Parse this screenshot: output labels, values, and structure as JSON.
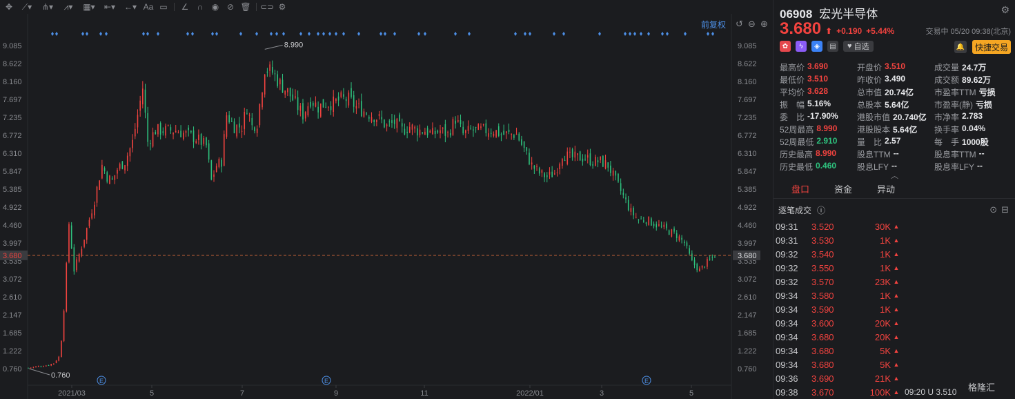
{
  "toolbar": {
    "icons": [
      "crosshair-icon",
      "line-tool-icon",
      "pitchfork-icon",
      "pattern-icon",
      "measure-icon",
      "range-icon",
      "arrow-tool-icon",
      "text-tool-icon",
      "comment-icon",
      "angle-icon",
      "magnet-icon",
      "eye-icon",
      "hide-icon",
      "trash-icon",
      "compare-icon",
      "gear-icon"
    ],
    "text_label": "Aa"
  },
  "chart": {
    "adjust_label": "前复权",
    "current_price_label": "3.680",
    "high_label": "8.990",
    "low_label": "0.760",
    "event_marker": "E"
  },
  "chart_data": {
    "type": "candlestick",
    "y_ticks": [
      "9.085",
      "8.622",
      "8.160",
      "7.697",
      "7.235",
      "6.772",
      "6.310",
      "5.847",
      "5.385",
      "4.922",
      "4.460",
      "3.997",
      "3.535",
      "3.072",
      "2.610",
      "2.147",
      "1.685",
      "1.222",
      "0.760"
    ],
    "x_ticks": [
      "2021/03",
      "5",
      "7",
      "9",
      "11",
      "2022/01",
      "3",
      "5"
    ],
    "ylim": [
      0.76,
      9.085
    ],
    "max_price": 8.99,
    "min_price": 0.76,
    "current_price": 3.68,
    "close_path": [
      [
        0,
        0.78
      ],
      [
        8,
        0.82
      ],
      [
        14,
        0.84
      ],
      [
        20,
        0.9
      ],
      [
        25,
        1.1
      ],
      [
        28,
        2.3
      ],
      [
        32,
        4.5
      ],
      [
        36,
        3.3
      ],
      [
        42,
        3.9
      ],
      [
        48,
        4.6
      ],
      [
        52,
        5.1
      ],
      [
        58,
        6.0
      ],
      [
        62,
        5.7
      ],
      [
        66,
        5.6
      ],
      [
        70,
        5.9
      ],
      [
        76,
        6.1
      ],
      [
        82,
        6.6
      ],
      [
        86,
        7.3
      ],
      [
        90,
        8.0
      ],
      [
        94,
        6.6
      ],
      [
        100,
        6.9
      ],
      [
        108,
        6.9
      ],
      [
        116,
        6.9
      ],
      [
        124,
        6.8
      ],
      [
        132,
        6.7
      ],
      [
        140,
        6.5
      ],
      [
        144,
        5.6
      ],
      [
        148,
        6.0
      ],
      [
        152,
        6.1
      ],
      [
        156,
        7.3
      ],
      [
        162,
        7.0
      ],
      [
        168,
        7.0
      ],
      [
        172,
        7.5
      ],
      [
        176,
        7.0
      ],
      [
        180,
        7.1
      ],
      [
        186,
        8.5
      ],
      [
        192,
        8.4
      ],
      [
        198,
        8.1
      ],
      [
        204,
        7.9
      ],
      [
        210,
        7.6
      ],
      [
        216,
        7.3
      ],
      [
        222,
        7.7
      ],
      [
        228,
        7.5
      ],
      [
        234,
        7.6
      ],
      [
        240,
        7.6
      ],
      [
        246,
        7.7
      ],
      [
        252,
        7.7
      ],
      [
        258,
        7.5
      ],
      [
        264,
        7.4
      ],
      [
        270,
        7.3
      ],
      [
        276,
        7.2
      ],
      [
        282,
        7.0
      ],
      [
        288,
        7.1
      ],
      [
        294,
        6.9
      ],
      [
        300,
        7.0
      ],
      [
        306,
        6.9
      ],
      [
        312,
        6.9
      ],
      [
        318,
        6.8
      ],
      [
        324,
        6.9
      ],
      [
        330,
        6.8
      ],
      [
        336,
        7.2
      ],
      [
        342,
        6.8
      ],
      [
        348,
        6.9
      ],
      [
        354,
        6.9
      ],
      [
        360,
        6.9
      ],
      [
        366,
        6.9
      ],
      [
        372,
        6.8
      ],
      [
        378,
        6.8
      ],
      [
        384,
        6.8
      ],
      [
        390,
        6.4
      ],
      [
        396,
        6.0
      ],
      [
        402,
        5.8
      ],
      [
        408,
        5.7
      ],
      [
        414,
        5.8
      ],
      [
        420,
        6.3
      ],
      [
        426,
        6.2
      ],
      [
        432,
        6.2
      ],
      [
        438,
        6.2
      ],
      [
        444,
        6.1
      ],
      [
        450,
        6.1
      ],
      [
        456,
        6.0
      ],
      [
        462,
        5.6
      ],
      [
        468,
        5.2
      ],
      [
        474,
        4.8
      ],
      [
        480,
        4.6
      ],
      [
        486,
        4.6
      ],
      [
        492,
        4.5
      ],
      [
        498,
        4.4
      ],
      [
        504,
        4.3
      ],
      [
        510,
        4.2
      ],
      [
        516,
        4.0
      ],
      [
        522,
        3.5
      ],
      [
        528,
        3.3
      ],
      [
        534,
        3.5
      ],
      [
        540,
        3.68
      ]
    ]
  },
  "stock": {
    "code": "06908",
    "name": "宏光半导体",
    "price": "3.680",
    "arrow": "⬆",
    "change": "+0.190",
    "change_pct": "+5.44%",
    "status": "交易中 05/20 09:38(北京)",
    "watch_label": "自选",
    "fast_trade_label": "快捷交易"
  },
  "stats": [
    [
      {
        "lbl": "最高价",
        "val": "3.690",
        "c": "red"
      },
      {
        "lbl": "开盘价",
        "val": "3.510",
        "c": "red"
      },
      {
        "lbl": "成交量",
        "val": "24.7万",
        "c": ""
      }
    ],
    [
      {
        "lbl": "最低价",
        "val": "3.510",
        "c": "red"
      },
      {
        "lbl": "昨收价",
        "val": "3.490",
        "c": ""
      },
      {
        "lbl": "成交额",
        "val": "89.62万",
        "c": ""
      }
    ],
    [
      {
        "lbl": "平均价",
        "val": "3.628",
        "c": "red"
      },
      {
        "lbl": "总市值",
        "val": "20.74亿",
        "c": ""
      },
      {
        "lbl": "市盈率TTM",
        "val": "亏损",
        "c": ""
      }
    ],
    [
      {
        "lbl": "振　幅",
        "val": "5.16%",
        "c": ""
      },
      {
        "lbl": "总股本",
        "val": "5.64亿",
        "c": ""
      },
      {
        "lbl": "市盈率(静)",
        "val": "亏损",
        "c": ""
      }
    ],
    [
      {
        "lbl": "委　比",
        "val": "-17.90%",
        "c": ""
      },
      {
        "lbl": "港股市值",
        "val": "20.740亿",
        "c": ""
      },
      {
        "lbl": "市净率",
        "val": "2.783",
        "c": ""
      }
    ],
    [
      {
        "lbl": "52周最高",
        "val": "8.990",
        "c": "red"
      },
      {
        "lbl": "港股股本",
        "val": "5.64亿",
        "c": ""
      },
      {
        "lbl": "换手率",
        "val": "0.04%",
        "c": ""
      }
    ],
    [
      {
        "lbl": "52周最低",
        "val": "2.910",
        "c": "green"
      },
      {
        "lbl": "量　比",
        "val": "2.57",
        "c": ""
      },
      {
        "lbl": "每　手",
        "val": "1000股",
        "c": ""
      }
    ],
    [
      {
        "lbl": "历史最高",
        "val": "8.990",
        "c": "red"
      },
      {
        "lbl": "股息TTM",
        "val": "--",
        "c": ""
      },
      {
        "lbl": "股息率TTM",
        "val": "--",
        "c": ""
      }
    ],
    [
      {
        "lbl": "历史最低",
        "val": "0.460",
        "c": "green"
      },
      {
        "lbl": "股息LFY",
        "val": "--",
        "c": ""
      },
      {
        "lbl": "股息率LFY",
        "val": "--",
        "c": ""
      }
    ]
  ],
  "tabs": [
    "盘口",
    "资金",
    "异动"
  ],
  "ticks_title": "逐笔成交",
  "ticks": [
    {
      "t": "09:31",
      "p": "3.520",
      "v": "30K"
    },
    {
      "t": "09:31",
      "p": "3.530",
      "v": "1K"
    },
    {
      "t": "09:32",
      "p": "3.540",
      "v": "1K"
    },
    {
      "t": "09:32",
      "p": "3.550",
      "v": "1K"
    },
    {
      "t": "09:32",
      "p": "3.570",
      "v": "23K"
    },
    {
      "t": "09:34",
      "p": "3.580",
      "v": "1K"
    },
    {
      "t": "09:34",
      "p": "3.590",
      "v": "1K"
    },
    {
      "t": "09:34",
      "p": "3.600",
      "v": "20K"
    },
    {
      "t": "09:34",
      "p": "3.680",
      "v": "20K"
    },
    {
      "t": "09:34",
      "p": "3.680",
      "v": "5K"
    },
    {
      "t": "09:34",
      "p": "3.680",
      "v": "5K"
    },
    {
      "t": "09:36",
      "p": "3.690",
      "v": "21K"
    },
    {
      "t": "09:38",
      "p": "3.670",
      "v": "100K",
      "extra": "09:20 U  3.510"
    }
  ],
  "brand": "格隆汇",
  "colors": {
    "up": "#f2433f",
    "down": "#2ec27e",
    "accent": "#4d8fe6",
    "bg": "#1b1c1f"
  }
}
